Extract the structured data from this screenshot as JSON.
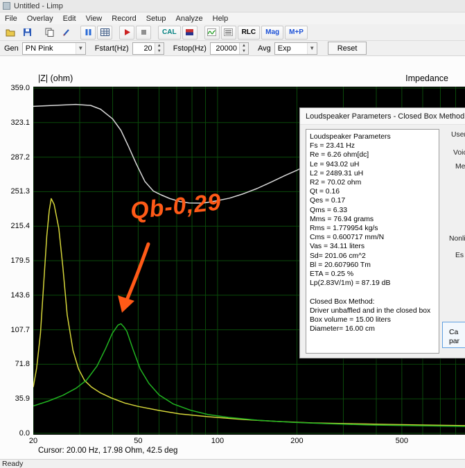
{
  "window": {
    "title": "Untitled - Limp"
  },
  "menu": {
    "items": [
      "File",
      "Overlay",
      "Edit",
      "View",
      "Record",
      "Setup",
      "Analyze",
      "Help"
    ]
  },
  "toolbar": {
    "cal_label": "CAL",
    "rlc_label": "RLC",
    "mag_label": "Mag",
    "mp_label": "M+P"
  },
  "generator_bar": {
    "gen_label": "Gen",
    "gen_value": "PN Pink",
    "fstart_label": "Fstart(Hz)",
    "fstart_value": "20",
    "fstop_label": "Fstop(Hz)",
    "fstop_value": "20000",
    "avg_label": "Avg",
    "avg_value": "Exp",
    "reset_label": "Reset"
  },
  "chart_data": {
    "type": "line",
    "title": "Impedance",
    "ylabel": "|Z| (ohm)",
    "x_scale": "log",
    "x_range": [
      20,
      868
    ],
    "y_range": [
      0,
      359
    ],
    "x_ticks": [
      20,
      50,
      100,
      200,
      500
    ],
    "x_grid": [
      20,
      30,
      40,
      50,
      60,
      70,
      80,
      90,
      100,
      200,
      300,
      400,
      500,
      600,
      700,
      800
    ],
    "y_ticks": [
      359.0,
      323.1,
      287.2,
      251.3,
      215.4,
      179.5,
      143.6,
      107.7,
      71.8,
      35.9,
      0.0
    ],
    "grid_color": "#0b4b0b",
    "background": "#000000",
    "legend_position": "none",
    "series": [
      {
        "name": "overlay-impedance-gray",
        "color": "#d9d9d9",
        "points": [
          [
            20,
            340
          ],
          [
            24,
            341
          ],
          [
            29,
            342
          ],
          [
            33,
            341
          ],
          [
            36,
            337
          ],
          [
            40,
            327
          ],
          [
            43,
            315
          ],
          [
            46,
            298
          ],
          [
            49,
            281
          ],
          [
            53,
            262
          ],
          [
            57,
            252
          ],
          [
            61,
            248
          ],
          [
            66,
            244
          ],
          [
            72,
            241
          ],
          [
            78,
            239.5
          ],
          [
            88,
            239.3
          ],
          [
            98,
            241.5
          ],
          [
            111,
            244.5
          ],
          [
            125,
            249
          ],
          [
            141,
            254.5
          ],
          [
            159,
            261
          ],
          [
            180,
            268
          ],
          [
            200,
            273.5
          ],
          [
            215,
            278
          ],
          [
            240,
            283
          ]
        ]
      },
      {
        "name": "free-air-impedance-yellow",
        "color": "#d6d63a",
        "points": [
          [
            20,
            48
          ],
          [
            20.6,
            68
          ],
          [
            21.3,
            104
          ],
          [
            21.9,
            155
          ],
          [
            22.5,
            205
          ],
          [
            23,
            232
          ],
          [
            23.4,
            244
          ],
          [
            24,
            238
          ],
          [
            25,
            213
          ],
          [
            25.9,
            173
          ],
          [
            26.9,
            123
          ],
          [
            28.3,
            86
          ],
          [
            29.7,
            67
          ],
          [
            31.3,
            55
          ],
          [
            33.3,
            48
          ],
          [
            36,
            42
          ],
          [
            39.4,
            37
          ],
          [
            44.5,
            31.5
          ],
          [
            50,
            28
          ],
          [
            60,
            23.8
          ],
          [
            72,
            20.2
          ],
          [
            92,
            17.3
          ],
          [
            125,
            14.4
          ],
          [
            169,
            12.3
          ],
          [
            230,
            10.8
          ],
          [
            311,
            10.1
          ],
          [
            422,
            9.4
          ],
          [
            572,
            8.7
          ],
          [
            776,
            8.2
          ],
          [
            868,
            8
          ]
        ]
      },
      {
        "name": "closed-box-impedance-green",
        "color": "#21b421",
        "points": [
          [
            20,
            28.5
          ],
          [
            22.8,
            33.5
          ],
          [
            25.9,
            39.5
          ],
          [
            29.1,
            47
          ],
          [
            31.9,
            55.5
          ],
          [
            34.9,
            70
          ],
          [
            37.6,
            88
          ],
          [
            39.9,
            104
          ],
          [
            41.9,
            112.5
          ],
          [
            43,
            114
          ],
          [
            44.3,
            110
          ],
          [
            45.3,
            106
          ],
          [
            47.7,
            88
          ],
          [
            50.9,
            67
          ],
          [
            54.9,
            52
          ],
          [
            60,
            40
          ],
          [
            68,
            30.5
          ],
          [
            79,
            24
          ],
          [
            92,
            19.5
          ],
          [
            110,
            16.6
          ],
          [
            141,
            13.7
          ],
          [
            190,
            11.5
          ],
          [
            258,
            10.1
          ],
          [
            372,
            8.7
          ],
          [
            572,
            7.9
          ],
          [
            868,
            7.2
          ]
        ]
      }
    ]
  },
  "annotation": {
    "text": "Qb-0,29",
    "color": "#ff5a17"
  },
  "dialog": {
    "title": "Loudspeaker Parameters - Closed Box Method",
    "lines": [
      "Loudspeaker Parameters",
      "Fs = 23.41 Hz",
      "Re = 6.26 ohm[dc]",
      "Le = 943.02 uH",
      "L2 = 2489.31 uH",
      "R2 = 70.02 ohm",
      "Qt = 0.16",
      "Qes = 0.17",
      "Qms = 6.33",
      "Mms = 76.94 grams",
      "Rms = 1.779954 kg/s",
      "Cms = 0.600717 mm/N",
      "Vas = 34.11 liters",
      "Sd= 201.06 cm^2",
      "Bl = 20.607960 Tm",
      "ETA = 0.25 %",
      "Lp(2.83V/1m) = 87.19 dB",
      "",
      "Closed Box Method:",
      "Driver unbaffled and in the closed box",
      "Box volume = 15.00 liters",
      "Diameter= 16.00 cm"
    ],
    "fragments": [
      "User",
      "Voic",
      "Me",
      "Nonlin",
      "Es"
    ],
    "calc_button_lines": [
      "Ca",
      "par"
    ]
  },
  "footer": {
    "cursor_text": "Cursor: 20.00 Hz, 17.98 Ohm, 42.5 deg",
    "status_text": "Ready"
  }
}
